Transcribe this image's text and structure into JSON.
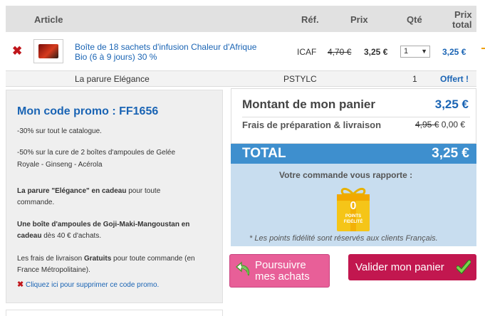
{
  "header": {
    "article": "Article",
    "ref": "Réf.",
    "prix": "Prix",
    "qte": "Qté",
    "prix_total_1": "Prix",
    "prix_total_2": "total"
  },
  "items": [
    {
      "name_line1": "Boîte de 18 sachets d'infusion Chaleur d'Afrique",
      "name_line2": "Bio (6 à 9 jours) 30 %",
      "ref": "ICAF",
      "old_price": "4,70 €",
      "price": "3,25 €",
      "qty": "1",
      "total": "3,25 €"
    },
    {
      "name": "La parure Elégance",
      "ref": "PSTYLC",
      "qty": "1",
      "total": "Offert !"
    }
  ],
  "promo": {
    "title": "Mon code promo : FF1656",
    "line1": "-30% sur tout le catalogue.",
    "line2a": "-50% sur la cure de 2 boîtes d'ampoules de Gelée",
    "line2b": "Royale - Ginseng - Acérola",
    "line3a_bold": "La parure \"Elégance\" en cadeau",
    "line3a_rest": " pour toute",
    "line3b": "commande.",
    "line4a": "Une boîte d'ampoules de Goji-Maki-Mangoustan en",
    "line4b_bold": "cadeau",
    "line4b_rest": " dès 40 € d'achats.",
    "line5a_pre": "Les frais de livraison ",
    "line5a_bold": "Gratuits",
    "line5a_rest": " pour toute commande (en",
    "line5b": "France Métropolitaine).",
    "remove_link": "Cliquez ici pour supprimer ce code promo."
  },
  "summary": {
    "basket_label": "Montant de mon panier",
    "basket_value": "3,25 €",
    "shipping_label": "Frais de préparation & livraison",
    "shipping_old": "4,95 €",
    "shipping_value": "0,00 €",
    "total_label": "TOTAL",
    "total_value": "3,25 €",
    "reward_text": "Votre commande vous rapporte :",
    "points_value": "0",
    "points_label_1": "POINTS",
    "points_label_2": "FIDÉLITÉ",
    "points_note": "* Les points fidélité sont réservés aux clients Français."
  },
  "buttons": {
    "continue_1": "Poursuivre",
    "continue_2": "mes achats",
    "validate": "Valider mon panier"
  },
  "colors": {
    "blue": "#1a64b4",
    "total_bar": "#3e8fce",
    "validate": "#c2174f",
    "continue": "#e85f98",
    "remove": "#c0161b"
  }
}
